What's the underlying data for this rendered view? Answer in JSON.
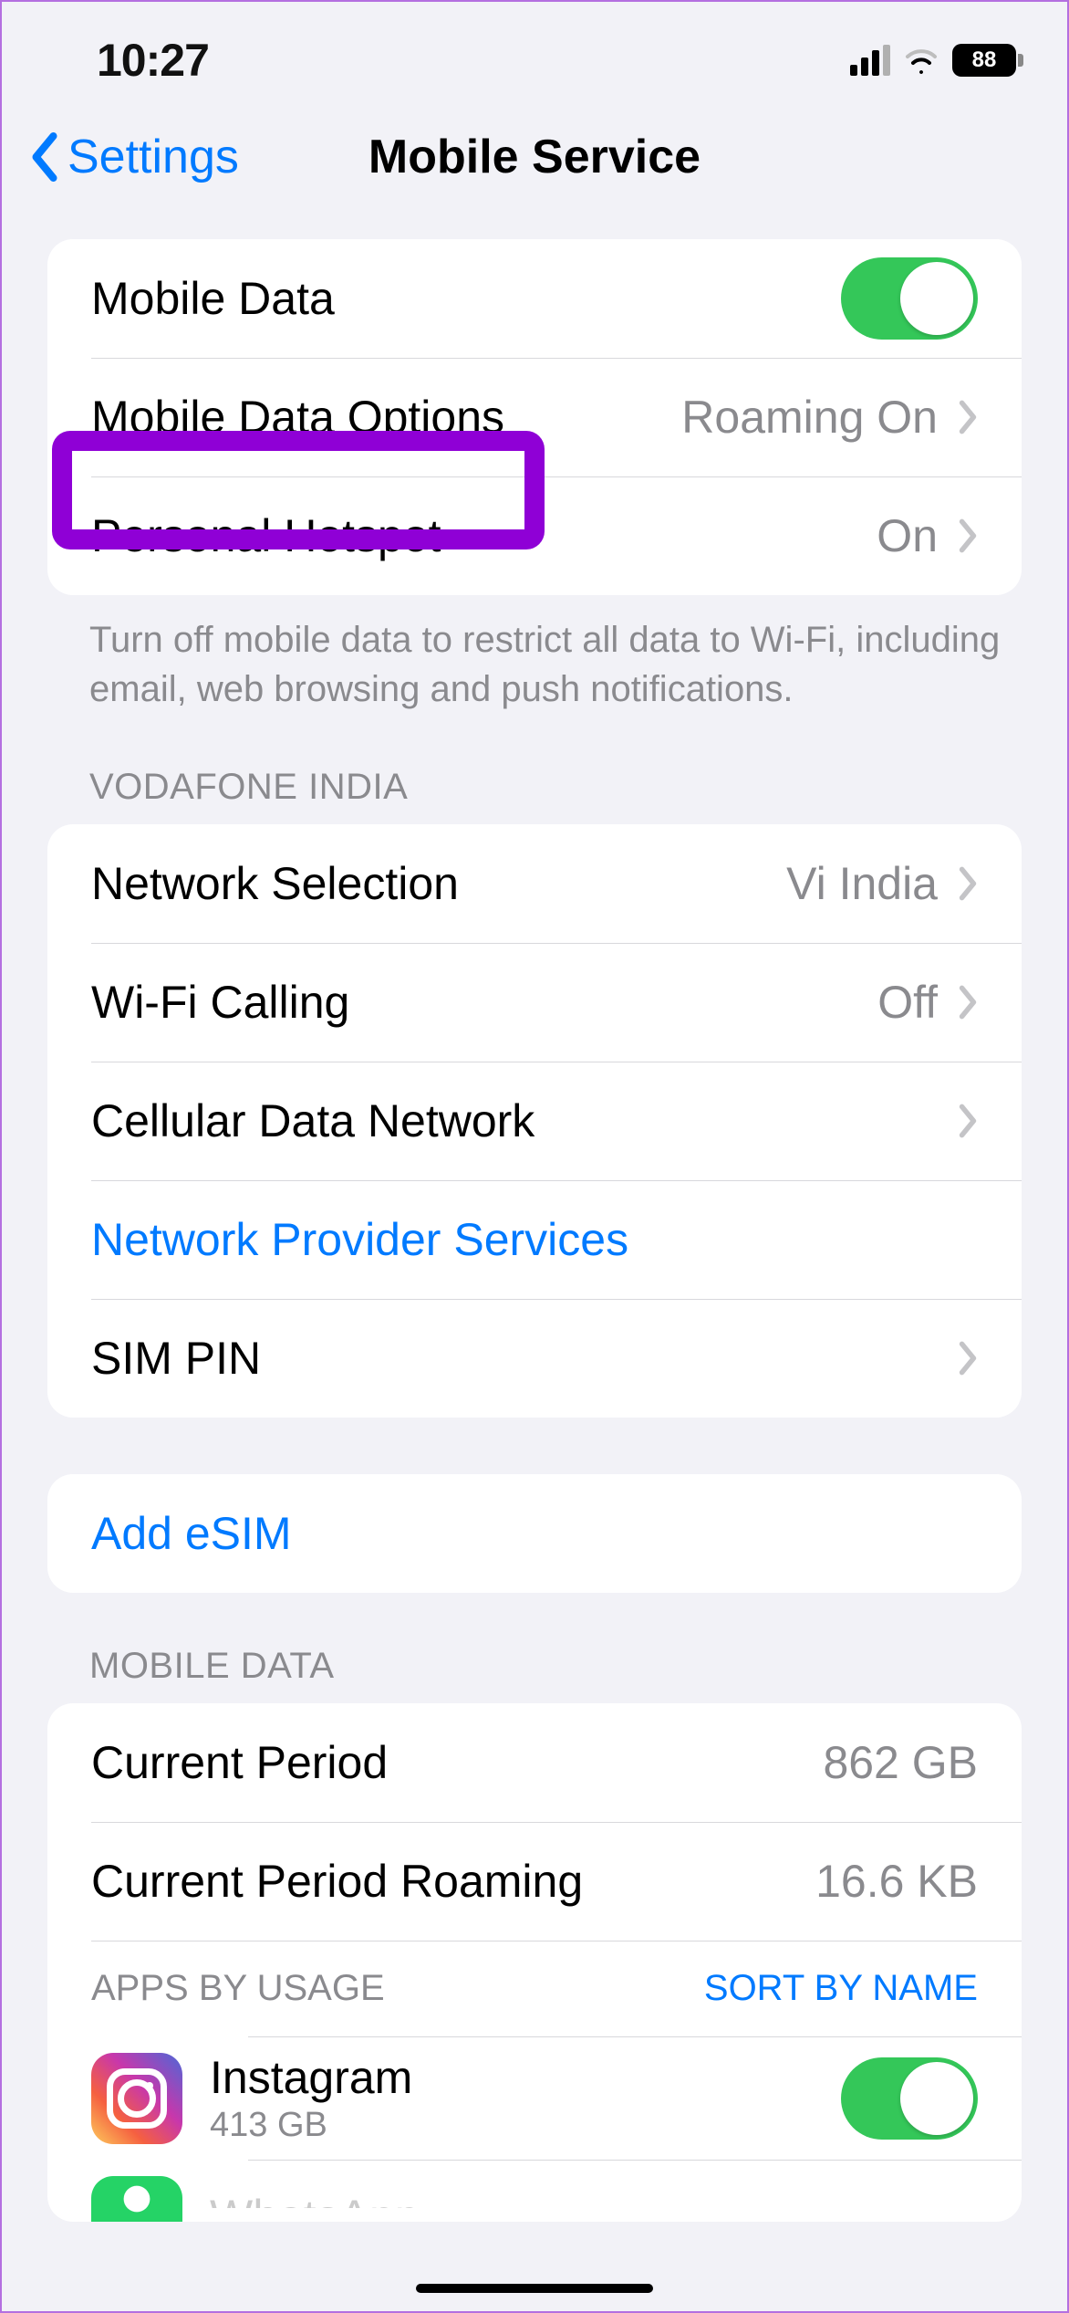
{
  "status": {
    "time": "10:27",
    "battery": "88"
  },
  "nav": {
    "back": "Settings",
    "title": "Mobile Service"
  },
  "group1": {
    "mobile_data": "Mobile Data",
    "mobile_data_options": "Mobile Data Options",
    "mobile_data_options_value": "Roaming On",
    "personal_hotspot": "Personal Hotspot",
    "personal_hotspot_value": "On",
    "footer": "Turn off mobile data to restrict all data to Wi-Fi, including email, web browsing and push notifications."
  },
  "carrier_header": "VODAFONE INDIA",
  "group2": {
    "network_selection": "Network Selection",
    "network_selection_value": "Vi India",
    "wifi_calling": "Wi-Fi Calling",
    "wifi_calling_value": "Off",
    "cellular_data_network": "Cellular Data Network",
    "network_provider_services": "Network Provider Services",
    "sim_pin": "SIM PIN"
  },
  "group3": {
    "add_esim": "Add eSIM"
  },
  "mobile_data_header": "MOBILE DATA",
  "group4": {
    "current_period": "Current Period",
    "current_period_value": "862 GB",
    "current_period_roaming": "Current Period Roaming",
    "current_period_roaming_value": "16.6 KB",
    "apps_by_usage": "APPS BY USAGE",
    "sort_by_name": "SORT BY NAME",
    "apps": [
      {
        "name": "Instagram",
        "size": "413 GB"
      },
      {
        "name": "WhatsApp",
        "size": ""
      }
    ]
  }
}
